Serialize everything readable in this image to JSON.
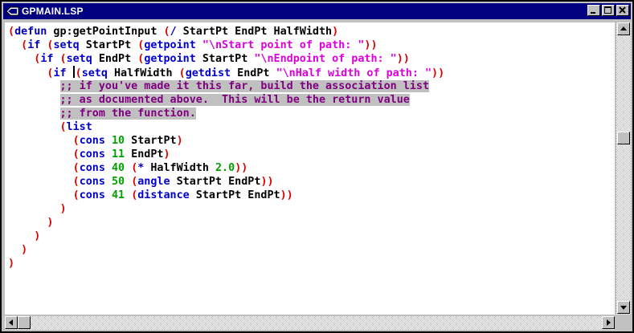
{
  "window": {
    "title": "GPMAIN.LSP",
    "controls": [
      "minimize-icon",
      "maximize-icon",
      "close-icon"
    ]
  },
  "editor": {
    "lines": [
      [
        [
          "p",
          "("
        ],
        [
          "fn",
          "defun"
        ],
        [
          "t",
          " gp:getPointInput "
        ],
        [
          "p",
          "("
        ],
        [
          "fn",
          "/"
        ],
        [
          "t",
          " StartPt EndPt HalfWidth"
        ],
        [
          "p",
          ")"
        ]
      ],
      [
        [
          "t",
          "  "
        ],
        [
          "p",
          "("
        ],
        [
          "fn",
          "if"
        ],
        [
          "t",
          " "
        ],
        [
          "p",
          "("
        ],
        [
          "fn",
          "setq"
        ],
        [
          "t",
          " StartPt "
        ],
        [
          "p",
          "("
        ],
        [
          "fn",
          "getpoint"
        ],
        [
          "t",
          " "
        ],
        [
          "s",
          "\"\\nStart point of path: \""
        ],
        [
          "p",
          "))"
        ]
      ],
      [
        [
          "t",
          "    "
        ],
        [
          "p",
          "("
        ],
        [
          "fn",
          "if"
        ],
        [
          "t",
          " "
        ],
        [
          "p",
          "("
        ],
        [
          "fn",
          "setq"
        ],
        [
          "t",
          " EndPt "
        ],
        [
          "p",
          "("
        ],
        [
          "fn",
          "getpoint"
        ],
        [
          "t",
          " StartPt "
        ],
        [
          "s",
          "\"\\nEndpoint of path: \""
        ],
        [
          "p",
          "))"
        ]
      ],
      [
        [
          "t",
          "      "
        ],
        [
          "p",
          "("
        ],
        [
          "fn",
          "if"
        ],
        [
          "t",
          " "
        ],
        [
          "cursor",
          ""
        ],
        [
          "p",
          "("
        ],
        [
          "fn",
          "setq"
        ],
        [
          "t",
          " HalfWidth "
        ],
        [
          "p",
          "("
        ],
        [
          "fn",
          "getdist"
        ],
        [
          "t",
          " EndPt "
        ],
        [
          "s",
          "\"\\nHalf width of path: \""
        ],
        [
          "p",
          "))"
        ]
      ],
      [
        [
          "t",
          "        "
        ],
        [
          "c",
          ";; if you've made it this far, build the association list"
        ]
      ],
      [
        [
          "t",
          "        "
        ],
        [
          "c",
          ";; as documented above.  This will be the return value"
        ]
      ],
      [
        [
          "t",
          "        "
        ],
        [
          "c",
          ";; from the function."
        ]
      ],
      [
        [
          "t",
          "        "
        ],
        [
          "p",
          "("
        ],
        [
          "fn",
          "list"
        ]
      ],
      [
        [
          "t",
          "          "
        ],
        [
          "p",
          "("
        ],
        [
          "fn",
          "cons"
        ],
        [
          "t",
          " "
        ],
        [
          "n",
          "10"
        ],
        [
          "t",
          " StartPt"
        ],
        [
          "p",
          ")"
        ]
      ],
      [
        [
          "t",
          "          "
        ],
        [
          "p",
          "("
        ],
        [
          "fn",
          "cons"
        ],
        [
          "t",
          " "
        ],
        [
          "n",
          "11"
        ],
        [
          "t",
          " EndPt"
        ],
        [
          "p",
          ")"
        ]
      ],
      [
        [
          "t",
          "          "
        ],
        [
          "p",
          "("
        ],
        [
          "fn",
          "cons"
        ],
        [
          "t",
          " "
        ],
        [
          "n",
          "40"
        ],
        [
          "t",
          " "
        ],
        [
          "p",
          "("
        ],
        [
          "fn",
          "*"
        ],
        [
          "t",
          " HalfWidth "
        ],
        [
          "n",
          "2.0"
        ],
        [
          "p",
          "))"
        ]
      ],
      [
        [
          "t",
          "          "
        ],
        [
          "p",
          "("
        ],
        [
          "fn",
          "cons"
        ],
        [
          "t",
          " "
        ],
        [
          "n",
          "50"
        ],
        [
          "t",
          " "
        ],
        [
          "p",
          "("
        ],
        [
          "fn",
          "angle"
        ],
        [
          "t",
          " StartPt EndPt"
        ],
        [
          "p",
          "))"
        ]
      ],
      [
        [
          "t",
          "          "
        ],
        [
          "p",
          "("
        ],
        [
          "fn",
          "cons"
        ],
        [
          "t",
          " "
        ],
        [
          "n",
          "41"
        ],
        [
          "t",
          " "
        ],
        [
          "p",
          "("
        ],
        [
          "fn",
          "distance"
        ],
        [
          "t",
          " StartPt EndPt"
        ],
        [
          "p",
          "))"
        ]
      ],
      [
        [
          "t",
          "        "
        ],
        [
          "p",
          ")"
        ]
      ],
      [
        [
          "t",
          "      "
        ],
        [
          "p",
          ")"
        ]
      ],
      [
        [
          "t",
          "    "
        ],
        [
          "p",
          ")"
        ]
      ],
      [
        [
          "t",
          "  "
        ],
        [
          "p",
          ")"
        ]
      ],
      [
        [
          "p",
          ")"
        ]
      ]
    ]
  },
  "scrollbars": {
    "vertical": {
      "up_icon": "arrow-up-icon",
      "down_icon": "arrow-down-icon"
    },
    "horizontal": {
      "left_icon": "arrow-left-icon",
      "right_icon": "arrow-right-icon"
    }
  },
  "colors": {
    "title_bar": "#000080",
    "paren": "#dd0000",
    "function": "#0000cc",
    "string": "#dd00dd",
    "number": "#00a000",
    "comment": "#800080",
    "comment_background": "#c0c0c0"
  }
}
